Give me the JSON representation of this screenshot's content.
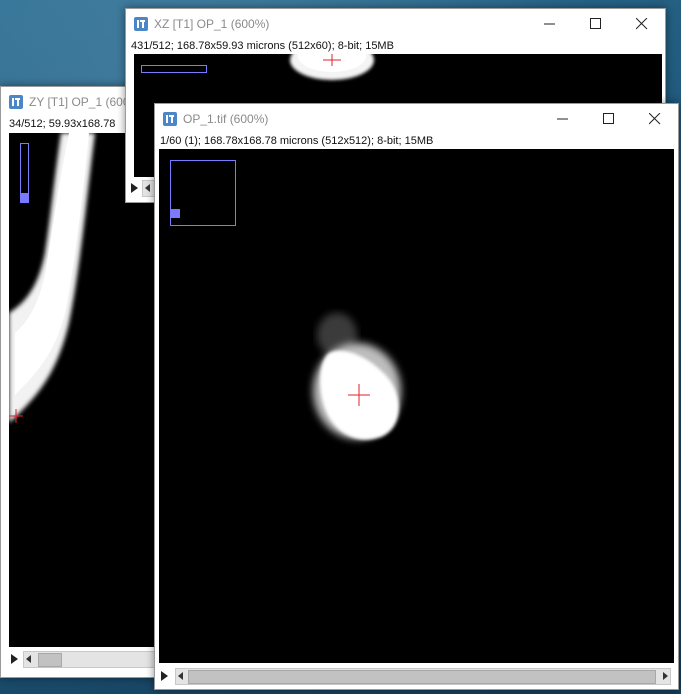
{
  "windows": {
    "zy": {
      "title": "ZY [T1] OP_1 (600",
      "info": "34/512; 59.93x168.78"
    },
    "xz": {
      "title": "XZ [T1] OP_1 (600%)",
      "info": "431/512; 168.78x59.93 microns (512x60); 8-bit; 15MB"
    },
    "op": {
      "title": "OP_1.tif (600%)",
      "info": "1/60 (1); 168.78x168.78 microns (512x512); 8-bit; 15MB"
    }
  },
  "icons": {
    "app": "imagej-icon",
    "minimize": "minimize-icon",
    "maximize": "maximize-icon",
    "close": "close-icon",
    "play": "play-icon",
    "crosshair": "crosshair-icon"
  },
  "colors": {
    "crosshair": "#e0202a",
    "navigator": "#7a7aff",
    "desktop": "#1d5577"
  }
}
